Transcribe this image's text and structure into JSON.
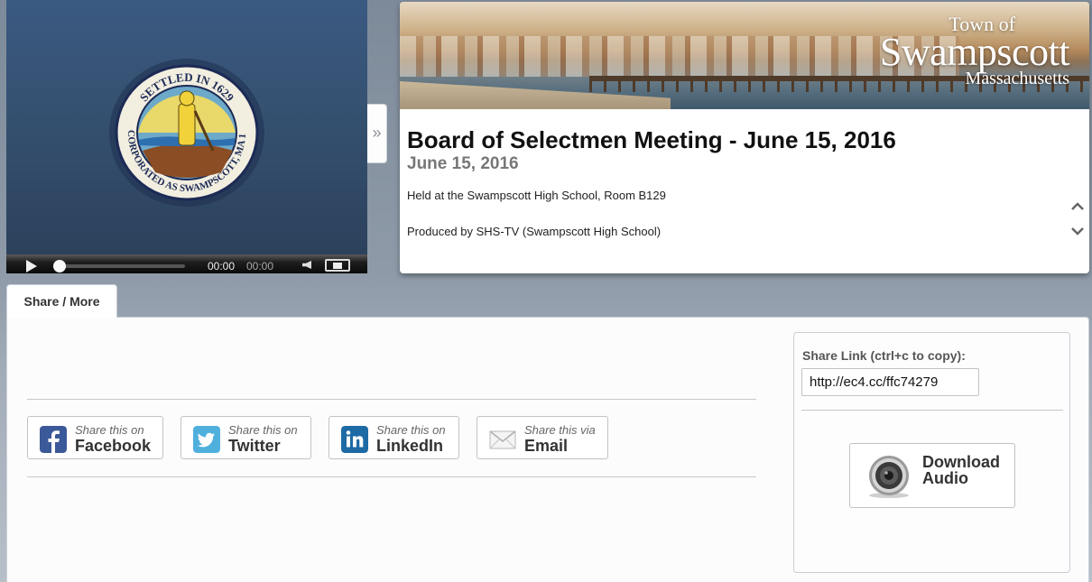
{
  "player": {
    "seal": {
      "top_text": "SETTLED IN 1629",
      "bottom_text": "INCORPORATED AS SWAMPSCOTT, MA 1852"
    },
    "time_current": "00:00",
    "time_total": "00:00",
    "progress": 0
  },
  "expand_label": "»",
  "banner": {
    "line1": "Town of",
    "line2": "Swampscott",
    "line3": "Massachusetts"
  },
  "meeting": {
    "title": "Board of Selectmen Meeting - June 15, 2016",
    "date": "June 15, 2016",
    "location": "Held at the Swampscott High School, Room B129",
    "producer": "Produced by SHS-TV (Swampscott High School)"
  },
  "tabs": [
    {
      "label": "Share / More"
    }
  ],
  "share_buttons": [
    {
      "small": "Share this on",
      "big": "Facebook",
      "icon": "facebook-icon",
      "color": "#3b5998"
    },
    {
      "small": "Share this on",
      "big": "Twitter",
      "icon": "twitter-icon",
      "color": "#4fb0dd"
    },
    {
      "small": "Share this on",
      "big": "LinkedIn",
      "icon": "linkedin-icon",
      "color": "#1d6aa5"
    },
    {
      "small": "Share this via",
      "big": "Email",
      "icon": "email-icon",
      "color": "#d8d8d8"
    }
  ],
  "share_link": {
    "label": "Share Link (ctrl+c to copy):",
    "value": "http://ec4.cc/ffc74279"
  },
  "download": {
    "line1": "Download",
    "line2": "Audio"
  }
}
